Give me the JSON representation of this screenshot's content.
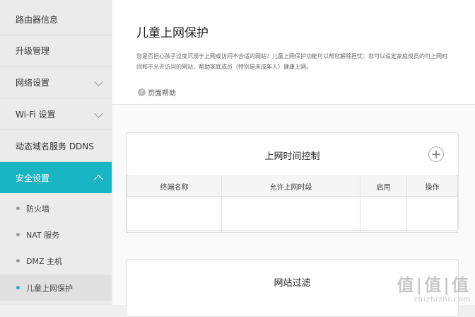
{
  "sidebar": {
    "items": [
      {
        "label": "路由器信息"
      },
      {
        "label": "升级管理"
      },
      {
        "label": "网络设置"
      },
      {
        "label": "Wi-Fi 设置"
      },
      {
        "label": "动态域名服务 DDNS"
      },
      {
        "label": "安全设置"
      }
    ],
    "sub_items": [
      {
        "label": "防火墙"
      },
      {
        "label": "NAT 服务"
      },
      {
        "label": "DMZ 主机"
      },
      {
        "label": "儿童上网保护"
      }
    ]
  },
  "main": {
    "title": "儿童上网保护",
    "description": "您是否担心孩子过度沉溺于上网或访问不合适的网站？儿童上网保护功能可以帮您解除担忧：您可以设定家庭成员的可上网时间和不允许访问的网站，帮助家庭成员（特别是未成年人）健康上网。",
    "help_label": "页面帮助",
    "time_card": {
      "title": "上网时间控制",
      "add_symbol": "+",
      "columns": [
        "终端名称",
        "允许上网时段",
        "启用",
        "操作"
      ]
    },
    "filter_card": {
      "title": "网站过滤"
    }
  },
  "watermark": {
    "logo": "值|值|值",
    "url": "zhizhizhi.com"
  },
  "colors": {
    "accent": "#1ab5c3",
    "sidebar_bg": "#ebebeb"
  }
}
